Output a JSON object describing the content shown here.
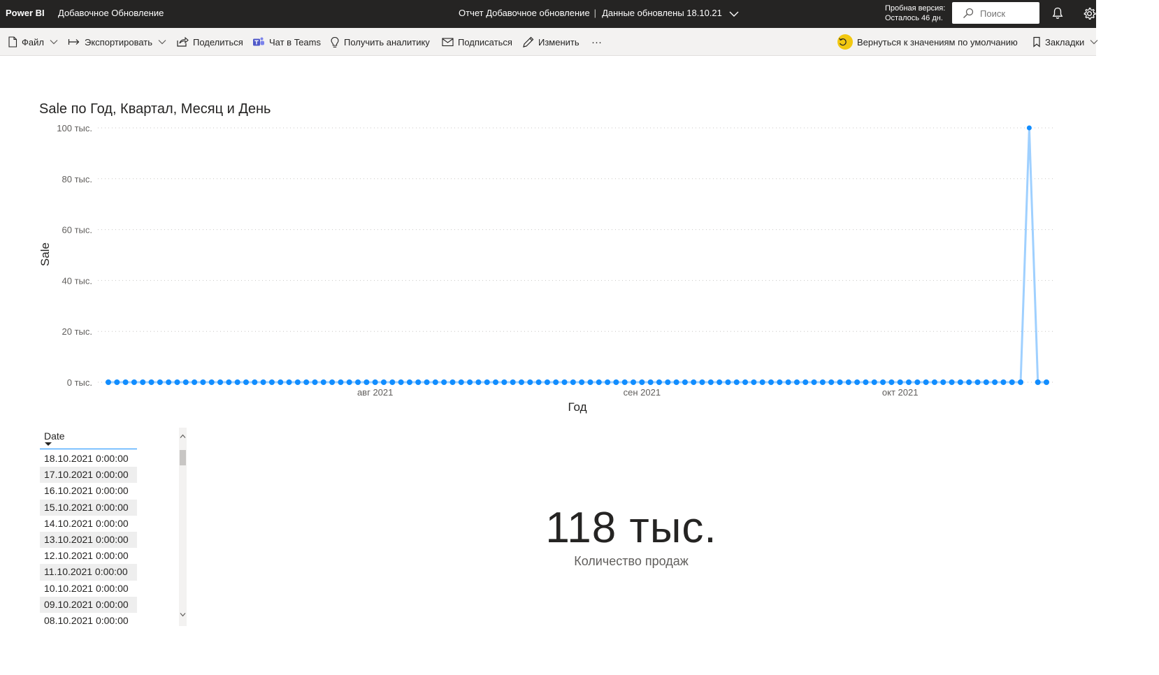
{
  "topbar": {
    "brand": "Power BI",
    "workspace": "Добавочное Обновление",
    "report_title": "Отчет Добавочное обновление",
    "separator": "|",
    "data_updated": "Данные обновлены 18.10.21",
    "trial_line1": "Пробная версия:",
    "trial_line2": "Осталось 46 дн.",
    "search_placeholder": "Поиск"
  },
  "actionbar": {
    "file": "Файл",
    "export": "Экспортировать",
    "share": "Поделиться",
    "teams": "Чат в Teams",
    "insights": "Получить аналитику",
    "subscribe": "Подписаться",
    "edit": "Изменить",
    "more": "···",
    "reset": "Вернуться к значениям по умолчанию",
    "bookmarks": "Закладки"
  },
  "chart_data": {
    "type": "line",
    "title": "Sale по Год, Квартал, Месяц и День",
    "xlabel": "Год",
    "ylabel": "Sale",
    "ylim": [
      0,
      100000
    ],
    "y_ticks": [
      {
        "value": 0,
        "label": "0 тыс."
      },
      {
        "value": 20000,
        "label": "20 тыс."
      },
      {
        "value": 40000,
        "label": "40 тыс."
      },
      {
        "value": 60000,
        "label": "60 тыс."
      },
      {
        "value": 80000,
        "label": "80 тыс."
      },
      {
        "value": 100000,
        "label": "100 тыс."
      }
    ],
    "x_start": "2021-07-01",
    "x_end": "2021-10-18",
    "x_ticks": [
      {
        "date": "2021-08-01",
        "label": "авг 2021"
      },
      {
        "date": "2021-09-01",
        "label": "сен 2021"
      },
      {
        "date": "2021-10-01",
        "label": "окт 2021"
      }
    ],
    "grid": true,
    "series_color": "#118dff",
    "line_color": "#9fd0ff",
    "baseline_value": 0,
    "peak": {
      "date": "2021-10-16",
      "value": 100000
    }
  },
  "slicer": {
    "header": "Date",
    "rows": [
      "18.10.2021 0:00:00",
      "17.10.2021 0:00:00",
      "16.10.2021 0:00:00",
      "15.10.2021 0:00:00",
      "14.10.2021 0:00:00",
      "13.10.2021 0:00:00",
      "12.10.2021 0:00:00",
      "11.10.2021 0:00:00",
      "10.10.2021 0:00:00",
      "09.10.2021 0:00:00",
      "08.10.2021 0:00:00"
    ]
  },
  "card": {
    "value": "118 тыс.",
    "label": "Количество продаж"
  }
}
